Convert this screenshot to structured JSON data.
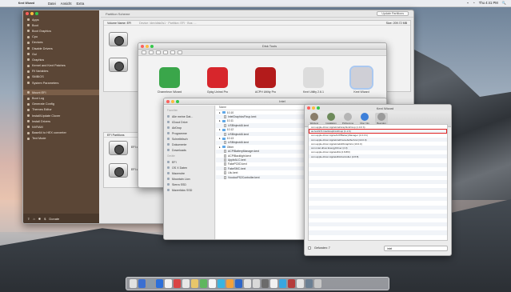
{
  "menubar": {
    "app": "Kext Wizard",
    "items": [
      "Datei",
      "Ansicht",
      "Extra"
    ],
    "status": [
      "⌁",
      "◔",
      "Thu 4:41 PM",
      "🔍"
    ]
  },
  "main": {
    "header": "Partition Scheme",
    "button": "Update Partitions",
    "volume_label": "Volume Name: EFI",
    "volume_info": "Device: /dev/disk0s1 · Partition: EFI · Bus: ...",
    "size_label": "Size: 209.72 MB",
    "efi_header": "EFI Partitions",
    "efi_items": [
      "EFI on",
      "EFI on"
    ],
    "sidebar": [
      {
        "label": "Apps"
      },
      {
        "label": "Boot"
      },
      {
        "label": "Boot Graphics"
      },
      {
        "label": "Cpu"
      },
      {
        "label": "Devices"
      },
      {
        "label": "Disable Drivers"
      },
      {
        "label": "Gui"
      },
      {
        "label": "Graphics"
      },
      {
        "label": "Kernel and Kext Patches"
      },
      {
        "label": "Rt Variables"
      },
      {
        "label": "SMBIOS"
      },
      {
        "label": "System Parameters"
      }
    ],
    "sidebar2": [
      {
        "label": "Mount EFI",
        "selected": true
      },
      {
        "label": "Boot Log"
      },
      {
        "label": "Generate Config"
      },
      {
        "label": "Themes Editor"
      },
      {
        "label": "Install/Update Clover"
      },
      {
        "label": "Install Drivers"
      },
      {
        "label": "NVRAM"
      },
      {
        "label": "Base64 to HEX converter"
      },
      {
        "label": "Text Mode"
      }
    ],
    "bottom": "Donate"
  },
  "tools": {
    "title": "Disk Tools",
    "apps": [
      {
        "label": "Chameleon Wizard",
        "color": "#3aa64a"
      },
      {
        "label": "Gpkg Uninst Pro",
        "color": "#d7262c"
      },
      {
        "label": "ACPH Utility Pro",
        "color": "#b31b1b"
      },
      {
        "label": "Kext Utility 2.6.1",
        "color": "#dcdcdc"
      },
      {
        "label": "Kext Wizard",
        "color": "#cfcfd6"
      }
    ]
  },
  "finder": {
    "title": "Intel",
    "sidebar_sections": [
      {
        "title": "Favoriten",
        "items": [
          "Alle meine Dat...",
          "iCloud Drive",
          "AirDrop",
          "Programme",
          "Schreibtisch",
          "Dokumente",
          "Downloads"
        ]
      },
      {
        "title": "Geräte",
        "items": [
          "EFI",
          "OS X Daten",
          "Macendre",
          "Mountain Lion",
          "Sierra SSD",
          "Maverlicks SSD"
        ]
      }
    ],
    "column": "Name",
    "rows": [
      {
        "t": "folder",
        "label": "10.10"
      },
      {
        "t": "doc",
        "label": "IntelGraphicsFixup.kext"
      },
      {
        "t": "folder",
        "label": "10.11"
      },
      {
        "t": "doc",
        "label": "USBInjectAll.kext"
      },
      {
        "t": "folder",
        "label": "10.12"
      },
      {
        "t": "doc",
        "label": "USBInjectAll.kext"
      },
      {
        "t": "folder",
        "label": "10.13"
      },
      {
        "t": "doc",
        "label": "USBInjectAll.kext"
      },
      {
        "t": "folder",
        "label": "Other"
      },
      {
        "t": "doc",
        "label": "ACPIBatteryManager.kext"
      },
      {
        "t": "doc",
        "label": "ACPIBacklight.kext"
      },
      {
        "t": "doc",
        "label": "AppleALC.kext"
      },
      {
        "t": "doc",
        "label": "FakePCIID.kext"
      },
      {
        "t": "doc",
        "label": "FakeSMC.kext"
      },
      {
        "t": "doc",
        "label": "Lilu.kext"
      },
      {
        "t": "doc",
        "label": "VoodooPS2Controller.kext"
      }
    ]
  },
  "kext": {
    "title": "Kext Wizard",
    "toolbar": [
      {
        "label": "Wartung",
        "color": "#8a7d6a"
      },
      {
        "label": "Installation",
        "color": "#6d8a5a"
      },
      {
        "label": "Prüfsumme",
        "color": "#b5b5b5"
      },
      {
        "label": "Über Info",
        "color": "#3d7fd9"
      },
      {
        "label": "Beenden",
        "color": "#9a9a9a",
        "selected": true
      }
    ],
    "rows": [
      "com.apple.driver.AppleIntelGraphicsFixup (1.0.0 b)",
      "as.lvs1974.IntelGraphicsFixup (1.1.6)",
      "com.apple.driver.AppleACPIBatteryManager (1.0.0 b)",
      "com.apple.driver.AppleIntelFramebufferAzul (10.0.0)",
      "com.apple.driver.AppleIntelHDGraphics (10.0.0)",
      "com.intel.driver.EnergyDriver (2.0)",
      "com.apple.driver.AppleHDA (2.8.8f3)",
      "com.apple.driver.AppleHDAController (2.8.8)"
    ],
    "highlight_index": 1,
    "bottom_label": "Gefunden: 7",
    "search_value": "intel"
  },
  "dock_colors": [
    "#e1e1e1",
    "#3b6fd1",
    "#8b9aa8",
    "#2c6fd9",
    "#f2f2f2",
    "#d94343",
    "#e7e7e7",
    "#e8c66a",
    "#5fb65f",
    "#f6f6f6",
    "#3ab4e0",
    "#f3a13b",
    "#2d66c9",
    "#e2e2e2",
    "#d9d9d9",
    "#6b6b6b",
    "#f1f1f1",
    "#39a6e0",
    "#b53b3b",
    "#e4e4e4",
    "#6b7f93",
    "#c7c7c7"
  ]
}
